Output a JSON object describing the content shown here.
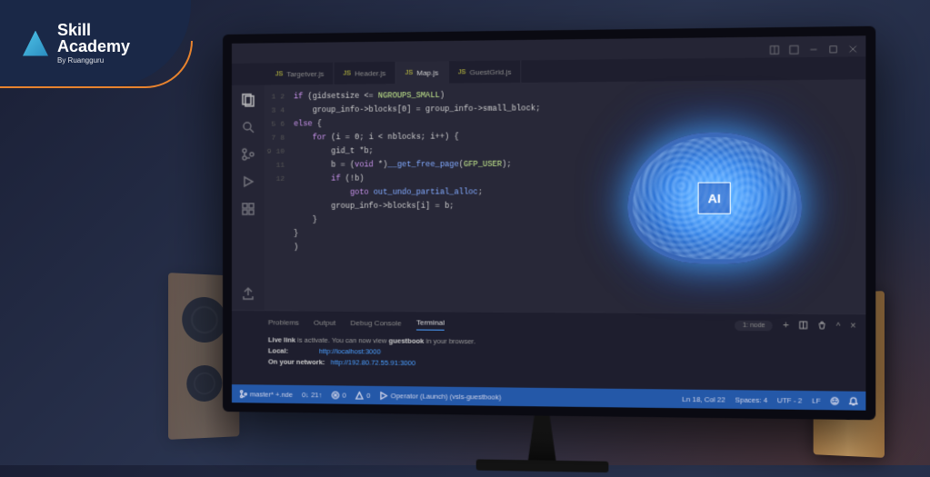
{
  "logo": {
    "line1": "Skill",
    "line2": "Academy",
    "byline": "By Ruangguru"
  },
  "tabs": [
    {
      "icon": "JS",
      "label": "Targetver.js"
    },
    {
      "icon": "JS",
      "label": "Header.js"
    },
    {
      "icon": "JS",
      "label": "Map.js",
      "active": true
    },
    {
      "icon": "JS",
      "label": "GuestGrid.js"
    }
  ],
  "code": {
    "lines": [
      "1",
      "2",
      "3",
      "4",
      "5",
      "6",
      "7",
      "8",
      "9",
      "10",
      "11",
      "12"
    ],
    "text": "if (gidsetsize <= NGROUPS_SMALL)\n    group_info->blocks[0] = group_info->small_block;\nelse {\n    for (i = 0; i < nblocks; i++) {\n        gid_t *b;\n        b = (void *)__get_free_page(GFP_USER);\n        if (!b)\n            goto out_undo_partial_alloc;\n        group_info->blocks[i] = b;\n    }\n}\n)"
  },
  "brain_label": "AI",
  "panel": {
    "tabs": [
      "Problems",
      "Output",
      "Debug Console",
      "Terminal"
    ],
    "active": 3,
    "node_label": "1: node",
    "body_intro": "Live link",
    "body_text": " is activate. You can now view ",
    "body_app": "guestbook",
    "body_suffix": " in your browser.",
    "local_label": "Local:",
    "local_url": "http://localhost:3000",
    "network_label": "On your network:",
    "network_url": "http://192.80.72.55.91:3000"
  },
  "status": {
    "branch": "master* +.nde",
    "sync": "0↓ 21↑",
    "errors": "0",
    "warnings": "0",
    "run": "Operator (Launch) (vsls-guestbook)",
    "position": "Ln 18, Col 22",
    "spaces": "Spaces: 4",
    "encoding": "UTF - 2",
    "eol": "LF"
  }
}
